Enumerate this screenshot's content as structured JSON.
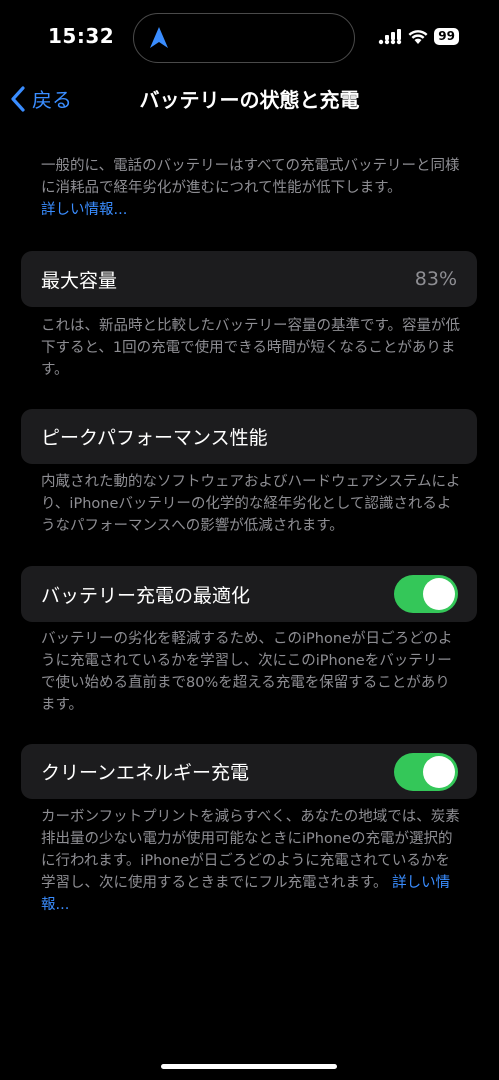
{
  "status_bar": {
    "time": "15:32",
    "battery_level": "99",
    "icons": [
      "location-arrow-icon",
      "cellular-signal-icon",
      "wifi-icon",
      "battery-icon"
    ]
  },
  "nav": {
    "back_label": "戻る",
    "title": "バッテリーの状態と充電"
  },
  "intro": {
    "text": "一般的に、電話のバッテリーはすべての充電式バッテリーと同様に消耗品で経年劣化が進むにつれて性能が低下します。",
    "link": "詳しい情報..."
  },
  "max_capacity": {
    "label": "最大容量",
    "value": "83%",
    "description": "これは、新品時と比較したバッテリー容量の基準です。容量が低下すると、1回の充電で使用できる時間が短くなることがあります。"
  },
  "peak_performance": {
    "label": "ピークパフォーマンス性能",
    "description": "内蔵された動的なソフトウェアおよびハードウェアシステムにより、iPhoneバッテリーの化学的な経年劣化として認識されるようなパフォーマンスへの影響が低減されます。"
  },
  "optimized_charging": {
    "label": "バッテリー充電の最適化",
    "enabled": true,
    "description": "バッテリーの劣化を軽減するため、このiPhoneが日ごろどのように充電されているかを学習し、次にこのiPhoneをバッテリーで使い始める直前まで80%を超える充電を保留することがあります。"
  },
  "clean_energy": {
    "label": "クリーンエネルギー充電",
    "enabled": true,
    "description": "カーボンフットプリントを減らすべく、あなたの地域では、炭素排出量の少ない電力が使用可能なときにiPhoneの充電が選択的に行われます。iPhoneが日ごろどのように充電されているかを学習し、次に使用するときまでにフル充電されます。",
    "link": "詳しい情報..."
  },
  "colors": {
    "background": "#000000",
    "card": "#1c1c1e",
    "secondary_text": "#8e8e93",
    "accent": "#3a8dff",
    "toggle_on": "#34c759"
  }
}
